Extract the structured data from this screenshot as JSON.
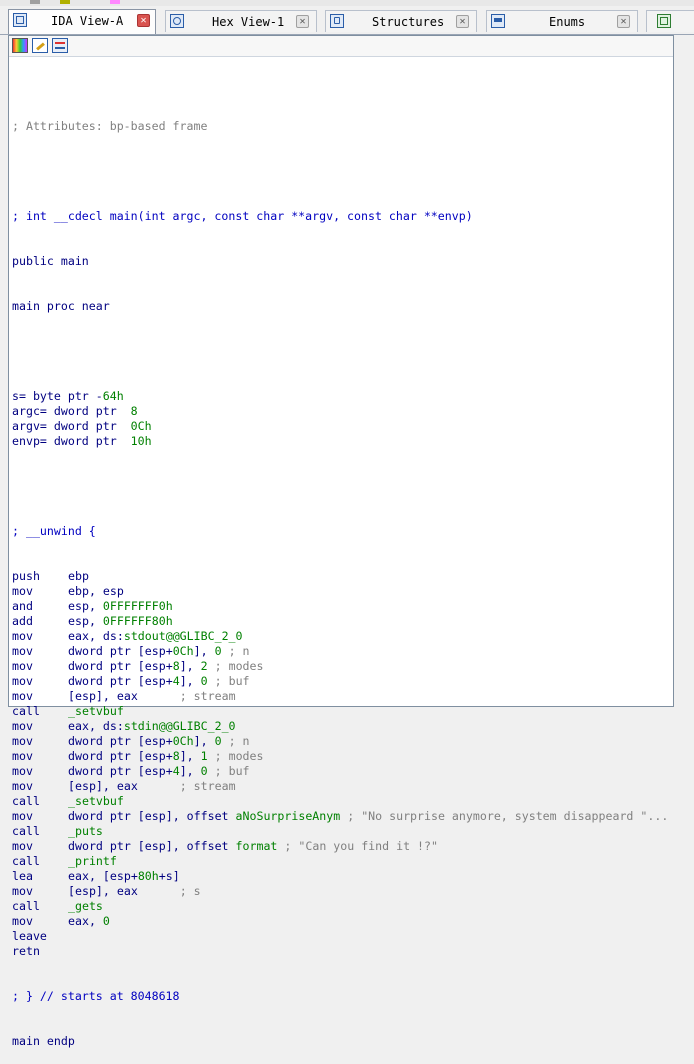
{
  "colors": {
    "keyword": "#000080",
    "comment": "#808080",
    "number": "#008000",
    "active_close": "#d9534f"
  },
  "tabs": [
    {
      "label": "IDA View-A",
      "icon": "ida-view-icon",
      "active": true
    },
    {
      "label": "Hex View-1",
      "icon": "hex-view-icon",
      "active": false
    },
    {
      "label": "Structures",
      "icon": "structures-icon",
      "active": false
    },
    {
      "label": "Enums",
      "icon": "enums-icon",
      "active": false
    }
  ],
  "toolbar": {
    "icons": [
      "graph-overview-icon",
      "edit-icon",
      "navigator-icon"
    ]
  },
  "disasm": {
    "attributes": "; Attributes: bp-based frame",
    "signature": "; int __cdecl main(int argc, const char **argv, const char **envp)",
    "public": "public main",
    "proc": "main proc near",
    "vars": [
      {
        "name": "s",
        "def": "= byte ptr -64h"
      },
      {
        "name": "argc",
        "def": "= dword ptr  8"
      },
      {
        "name": "argv",
        "def": "= dword ptr  0Ch"
      },
      {
        "name": "envp",
        "def": "= dword ptr  10h"
      }
    ],
    "unwind": "; __unwind {",
    "instructions": [
      {
        "mnem": "push",
        "ops": "ebp",
        "comment": ""
      },
      {
        "mnem": "mov",
        "ops": "ebp, esp",
        "comment": ""
      },
      {
        "mnem": "and",
        "ops": "esp, 0FFFFFFF0h",
        "comment": ""
      },
      {
        "mnem": "add",
        "ops": "esp, 0FFFFFF80h",
        "comment": ""
      },
      {
        "mnem": "mov",
        "ops": "eax, ds:stdout@@GLIBC_2_0",
        "comment": ""
      },
      {
        "mnem": "mov",
        "ops": "dword ptr [esp+0Ch], 0",
        "comment": "; n"
      },
      {
        "mnem": "mov",
        "ops": "dword ptr [esp+8], 2",
        "comment": "; modes"
      },
      {
        "mnem": "mov",
        "ops": "dword ptr [esp+4], 0",
        "comment": "; buf"
      },
      {
        "mnem": "mov",
        "ops": "[esp], eax     ",
        "comment": "; stream"
      },
      {
        "mnem": "call",
        "ops": "_setvbuf",
        "comment": ""
      },
      {
        "mnem": "mov",
        "ops": "eax, ds:stdin@@GLIBC_2_0",
        "comment": ""
      },
      {
        "mnem": "mov",
        "ops": "dword ptr [esp+0Ch], 0",
        "comment": "; n"
      },
      {
        "mnem": "mov",
        "ops": "dword ptr [esp+8], 1",
        "comment": "; modes"
      },
      {
        "mnem": "mov",
        "ops": "dword ptr [esp+4], 0",
        "comment": "; buf"
      },
      {
        "mnem": "mov",
        "ops": "[esp], eax     ",
        "comment": "; stream"
      },
      {
        "mnem": "call",
        "ops": "_setvbuf",
        "comment": ""
      },
      {
        "mnem": "mov",
        "ops": "dword ptr [esp], offset aNoSurpriseAnym",
        "comment": "; \"No surprise anymore, system disappeard \"..."
      },
      {
        "mnem": "call",
        "ops": "_puts",
        "comment": ""
      },
      {
        "mnem": "mov",
        "ops": "dword ptr [esp], offset format",
        "comment": "; \"Can you find it !?\""
      },
      {
        "mnem": "call",
        "ops": "_printf",
        "comment": ""
      },
      {
        "mnem": "lea",
        "ops": "eax, [esp+80h+s]",
        "comment": ""
      },
      {
        "mnem": "mov",
        "ops": "[esp], eax     ",
        "comment": "; s"
      },
      {
        "mnem": "call",
        "ops": "_gets",
        "comment": ""
      },
      {
        "mnem": "mov",
        "ops": "eax, 0",
        "comment": ""
      },
      {
        "mnem": "leave",
        "ops": "",
        "comment": ""
      },
      {
        "mnem": "retn",
        "ops": "",
        "comment": ""
      }
    ],
    "unwind_end": "; } // starts at 8048618",
    "endp": "main endp"
  }
}
